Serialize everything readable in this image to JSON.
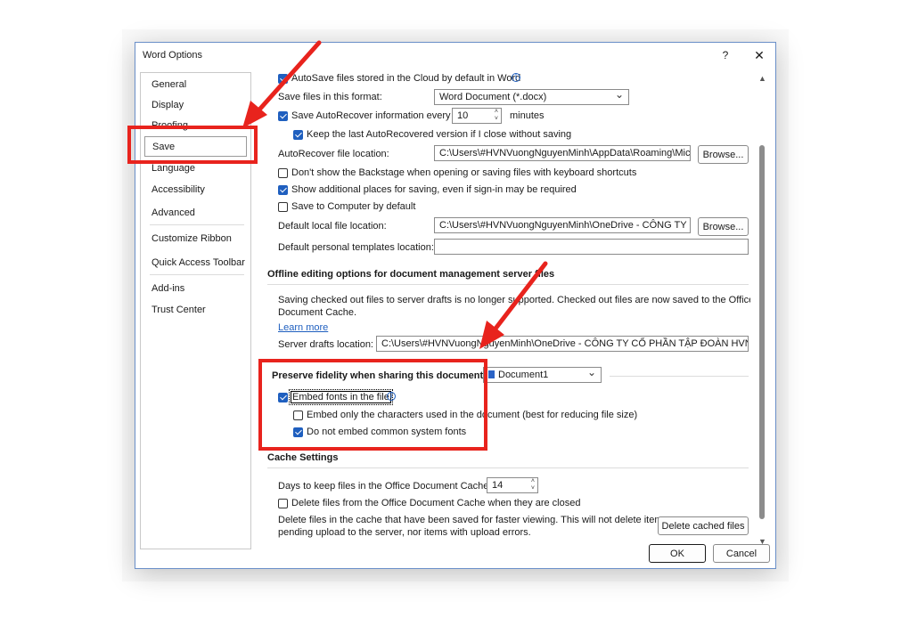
{
  "window": {
    "title": "Word Options",
    "help": "?",
    "close": "✕"
  },
  "nav": {
    "items": [
      "General",
      "Display",
      "Proofing",
      "Save",
      "Language",
      "Accessibility",
      "Advanced",
      "Customize Ribbon",
      "Quick Access Toolbar",
      "Add-ins",
      "Trust Center"
    ],
    "selected": "Save"
  },
  "save": {
    "autosave_cloud": {
      "label": "AutoSave files stored in the Cloud by default in Word",
      "checked": true
    },
    "format_label": "Save files in this format:",
    "format_value": "Word Document (*.docx)",
    "autorecover": {
      "label": "Save AutoRecover information every",
      "checked": true,
      "value": "10",
      "unit": "minutes"
    },
    "keep_last": {
      "label": "Keep the last AutoRecovered version if I close without saving",
      "checked": true
    },
    "autorecover_location_label": "AutoRecover file location:",
    "autorecover_location_value": "C:\\Users\\#HVNVuongNguyenMinh\\AppData\\Roaming\\Micr",
    "browse1": "Browse...",
    "dont_show_backstage": {
      "label": "Don't show the Backstage when opening or saving files with keyboard shortcuts",
      "checked": false
    },
    "show_additional": {
      "label": "Show additional places for saving, even if sign-in may be required",
      "checked": true
    },
    "save_to_computer": {
      "label": "Save to Computer by default",
      "checked": false
    },
    "default_local_label": "Default local file location:",
    "default_local_value": "C:\\Users\\#HVNVuongNguyenMinh\\OneDrive - CÔNG TY CC",
    "browse2": "Browse...",
    "default_templates_label": "Default personal templates location:",
    "default_templates_value": ""
  },
  "offline": {
    "heading": "Offline editing options for document management server files",
    "desc_line1": "Saving checked out files to server drafts is no longer supported. Checked out files are now saved to the Office",
    "desc_line2": "Document Cache.",
    "learn_more": "Learn more",
    "server_drafts_label": "Server drafts location:",
    "server_drafts_value": "C:\\Users\\#HVNVuongNguyenMinh\\OneDrive - CÔNG TY CỔ PHẦN TẬP ĐOÀN HVN\\Do"
  },
  "fidelity": {
    "label": "Preserve fidelity when sharing this document:",
    "doc_value": "Document1",
    "embed_fonts": {
      "label": "Embed fonts in the file",
      "checked": true
    },
    "embed_only_used": {
      "label": "Embed only the characters used in the document (best for reducing file size)",
      "checked": false
    },
    "do_not_embed_system": {
      "label": "Do not embed common system fonts",
      "checked": true
    }
  },
  "cache": {
    "heading": "Cache Settings",
    "days_label": "Days to keep files in the Office Document Cache:",
    "days_value": "14",
    "delete_on_close": {
      "label": "Delete files from the Office Document Cache when they are closed",
      "checked": false
    },
    "delete_desc_line1": "Delete files in the cache that have been saved for faster viewing. This will not delete items",
    "delete_desc_line2": "pending upload to the server, nor items with upload errors.",
    "delete_button": "Delete cached files"
  },
  "footer": {
    "ok": "OK",
    "cancel": "Cancel"
  },
  "colors": {
    "annotation_red": "#e8231d",
    "checkbox_blue": "#1f5fbf",
    "dialog_border": "#6a8fc8"
  },
  "icons": [
    "info-icon",
    "chevron-down-icon",
    "spin-arrows-icon",
    "document-icon",
    "scroll-up-icon",
    "scroll-down-icon"
  ]
}
